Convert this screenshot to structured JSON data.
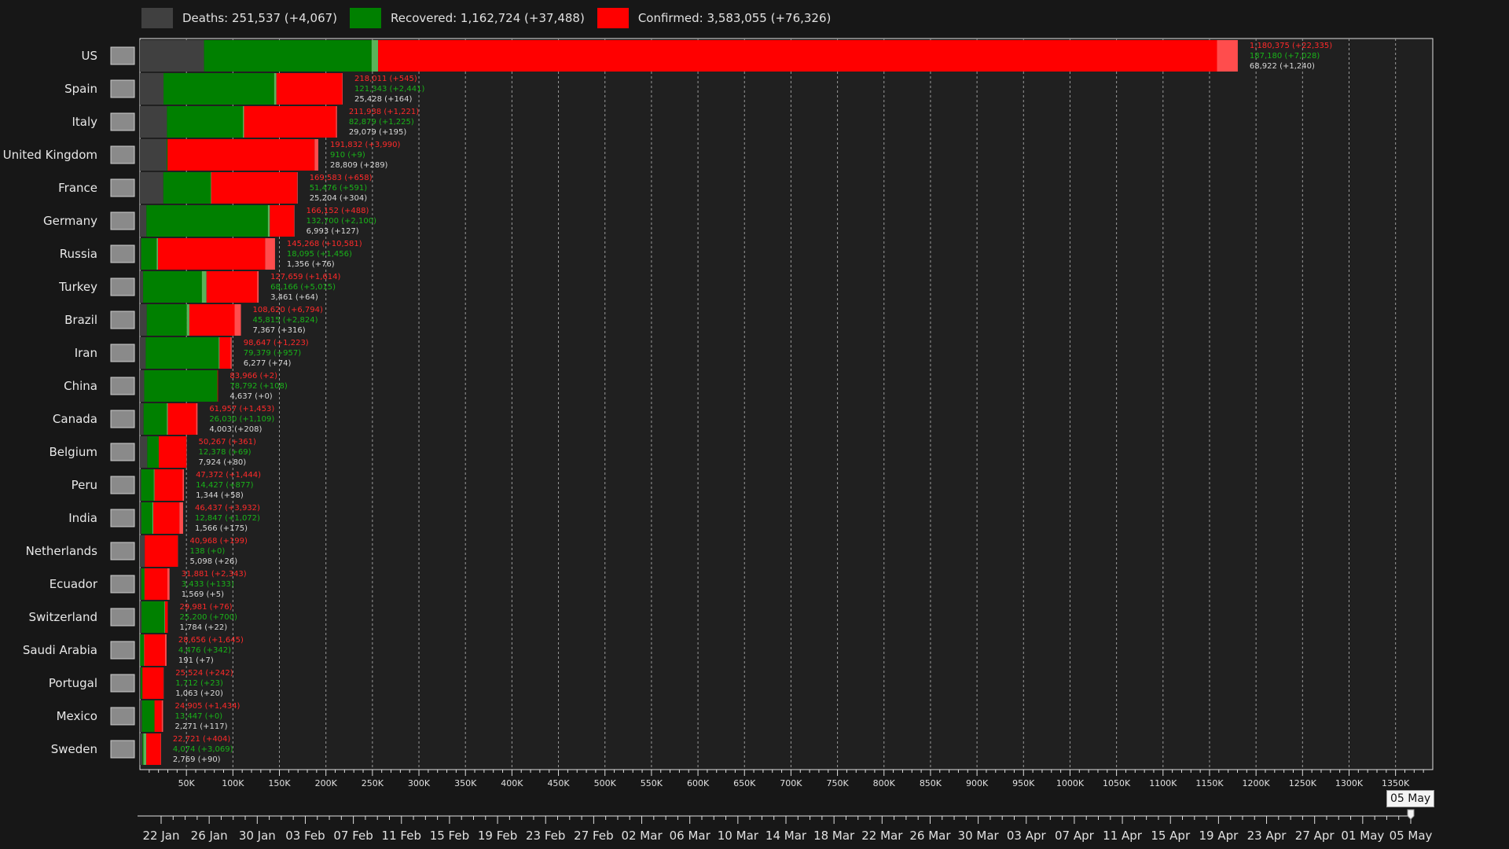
{
  "legend": [
    {
      "label": "Deaths: 251,537 (+4,067)",
      "color": "#404040"
    },
    {
      "label": "Recovered: 1,162,724 (+37,488)",
      "color": "#008000"
    },
    {
      "label": "Confirmed: 3,583,055 (+76,326)",
      "color": "#ff0000"
    }
  ],
  "colors": {
    "deaths": "#404040",
    "recovered": "#008000",
    "confirmed": "#ff0000",
    "confirmed_new": "#ff4d4d",
    "recovered_new": "#59b359",
    "text_red": "#ff2a2a",
    "text_green": "#19b219",
    "text_gray": "#d8d8d8"
  },
  "chart_data": {
    "type": "bar",
    "orientation": "horizontal",
    "xlim": [
      0,
      1390000
    ],
    "x_ticks": [
      "50K",
      "100K",
      "150K",
      "200K",
      "250K",
      "300K",
      "350K",
      "400K",
      "450K",
      "500K",
      "550K",
      "600K",
      "650K",
      "700K",
      "750K",
      "800K",
      "850K",
      "900K",
      "950K",
      "1000K",
      "1050K",
      "1100K",
      "1150K",
      "1200K",
      "1250K",
      "1300K",
      "1350K"
    ],
    "grid": true,
    "rows": [
      {
        "country": "US",
        "flag": "us-flag-icon",
        "confirmed": 1180375,
        "confirmed_new": 22335,
        "recovered": 187180,
        "recovered_new": 7028,
        "deaths": 68922,
        "deaths_new": 1240,
        "confirmed_label": "1,180,375 (+22,335)",
        "recovered_label": "187,180 (+7,028)",
        "deaths_label": "68,922 (+1,240)"
      },
      {
        "country": "Spain",
        "flag": "spain-flag-icon",
        "confirmed": 218011,
        "confirmed_new": 545,
        "recovered": 121343,
        "recovered_new": 2441,
        "deaths": 25428,
        "deaths_new": 164,
        "confirmed_label": "218,011 (+545)",
        "recovered_label": "121,343 (+2,441)",
        "deaths_label": "25,428 (+164)"
      },
      {
        "country": "Italy",
        "flag": "italy-flag-icon",
        "confirmed": 211938,
        "confirmed_new": 1221,
        "recovered": 82879,
        "recovered_new": 1225,
        "deaths": 29079,
        "deaths_new": 195,
        "confirmed_label": "211,938 (+1,221)",
        "recovered_label": "82,879 (+1,225)",
        "deaths_label": "29,079 (+195)"
      },
      {
        "country": "United Kingdom",
        "flag": "uk-flag-icon",
        "confirmed": 191832,
        "confirmed_new": 3990,
        "recovered": 910,
        "recovered_new": 9,
        "deaths": 28809,
        "deaths_new": 289,
        "confirmed_label": "191,832 (+3,990)",
        "recovered_label": "910 (+9)",
        "deaths_label": "28,809 (+289)"
      },
      {
        "country": "France",
        "flag": "france-flag-icon",
        "confirmed": 169583,
        "confirmed_new": 658,
        "recovered": 51476,
        "recovered_new": 591,
        "deaths": 25204,
        "deaths_new": 304,
        "confirmed_label": "169,583 (+658)",
        "recovered_label": "51,476 (+591)",
        "deaths_label": "25,204 (+304)"
      },
      {
        "country": "Germany",
        "flag": "germany-flag-icon",
        "confirmed": 166152,
        "confirmed_new": 488,
        "recovered": 132700,
        "recovered_new": 2100,
        "deaths": 6993,
        "deaths_new": 127,
        "confirmed_label": "166,152 (+488)",
        "recovered_label": "132,700 (+2,100)",
        "deaths_label": "6,993 (+127)"
      },
      {
        "country": "Russia",
        "flag": "russia-flag-icon",
        "confirmed": 145268,
        "confirmed_new": 10581,
        "recovered": 18095,
        "recovered_new": 1456,
        "deaths": 1356,
        "deaths_new": 76,
        "confirmed_label": "145,268 (+10,581)",
        "recovered_label": "18,095 (+1,456)",
        "deaths_label": "1,356 (+76)"
      },
      {
        "country": "Turkey",
        "flag": "turkey-flag-icon",
        "confirmed": 127659,
        "confirmed_new": 1614,
        "recovered": 68166,
        "recovered_new": 5015,
        "deaths": 3461,
        "deaths_new": 64,
        "confirmed_label": "127,659 (+1,614)",
        "recovered_label": "68,166 (+5,015)",
        "deaths_label": "3,461 (+64)"
      },
      {
        "country": "Brazil",
        "flag": "brazil-flag-icon",
        "confirmed": 108620,
        "confirmed_new": 6794,
        "recovered": 45815,
        "recovered_new": 2824,
        "deaths": 7367,
        "deaths_new": 316,
        "confirmed_label": "108,620 (+6,794)",
        "recovered_label": "45,815 (+2,824)",
        "deaths_label": "7,367 (+316)"
      },
      {
        "country": "Iran",
        "flag": "iran-flag-icon",
        "confirmed": 98647,
        "confirmed_new": 1223,
        "recovered": 79379,
        "recovered_new": 957,
        "deaths": 6277,
        "deaths_new": 74,
        "confirmed_label": "98,647 (+1,223)",
        "recovered_label": "79,379 (+957)",
        "deaths_label": "6,277 (+74)"
      },
      {
        "country": "China",
        "flag": "china-flag-icon",
        "confirmed": 83966,
        "confirmed_new": 2,
        "recovered": 78792,
        "recovered_new": 108,
        "deaths": 4637,
        "deaths_new": 0,
        "confirmed_label": "83,966 (+2)",
        "recovered_label": "78,792 (+108)",
        "deaths_label": "4,637 (+0)"
      },
      {
        "country": "Canada",
        "flag": "canada-flag-icon",
        "confirmed": 61957,
        "confirmed_new": 1453,
        "recovered": 26030,
        "recovered_new": 1109,
        "deaths": 4003,
        "deaths_new": 208,
        "confirmed_label": "61,957 (+1,453)",
        "recovered_label": "26,030 (+1,109)",
        "deaths_label": "4,003 (+208)"
      },
      {
        "country": "Belgium",
        "flag": "belgium-flag-icon",
        "confirmed": 50267,
        "confirmed_new": 361,
        "recovered": 12378,
        "recovered_new": 69,
        "deaths": 7924,
        "deaths_new": 80,
        "confirmed_label": "50,267 (+361)",
        "recovered_label": "12,378 (+69)",
        "deaths_label": "7,924 (+80)"
      },
      {
        "country": "Peru",
        "flag": "peru-flag-icon",
        "confirmed": 47372,
        "confirmed_new": 1444,
        "recovered": 14427,
        "recovered_new": 877,
        "deaths": 1344,
        "deaths_new": 58,
        "confirmed_label": "47,372 (+1,444)",
        "recovered_label": "14,427 (+877)",
        "deaths_label": "1,344 (+58)"
      },
      {
        "country": "India",
        "flag": "india-flag-icon",
        "confirmed": 46437,
        "confirmed_new": 3932,
        "recovered": 12847,
        "recovered_new": 1072,
        "deaths": 1566,
        "deaths_new": 175,
        "confirmed_label": "46,437 (+3,932)",
        "recovered_label": "12,847 (+1,072)",
        "deaths_label": "1,566 (+175)"
      },
      {
        "country": "Netherlands",
        "flag": "netherlands-flag-icon",
        "confirmed": 40968,
        "confirmed_new": 199,
        "recovered": 138,
        "recovered_new": 0,
        "deaths": 5098,
        "deaths_new": 26,
        "confirmed_label": "40,968 (+199)",
        "recovered_label": "138 (+0)",
        "deaths_label": "5,098 (+26)"
      },
      {
        "country": "Ecuador",
        "flag": "ecuador-flag-icon",
        "confirmed": 31881,
        "confirmed_new": 2343,
        "recovered": 3433,
        "recovered_new": 133,
        "deaths": 1569,
        "deaths_new": 5,
        "confirmed_label": "31,881 (+2,343)",
        "recovered_label": "3,433 (+133)",
        "deaths_label": "1,569 (+5)"
      },
      {
        "country": "Switzerland",
        "flag": "switzerland-flag-icon",
        "confirmed": 29981,
        "confirmed_new": 76,
        "recovered": 25200,
        "recovered_new": 700,
        "deaths": 1784,
        "deaths_new": 22,
        "confirmed_label": "29,981 (+76)",
        "recovered_label": "25,200 (+700)",
        "deaths_label": "1,784 (+22)"
      },
      {
        "country": "Saudi Arabia",
        "flag": "saudi-arabia-flag-icon",
        "confirmed": 28656,
        "confirmed_new": 1645,
        "recovered": 4476,
        "recovered_new": 342,
        "deaths": 191,
        "deaths_new": 7,
        "confirmed_label": "28,656 (+1,645)",
        "recovered_label": "4,476 (+342)",
        "deaths_label": "191 (+7)"
      },
      {
        "country": "Portugal",
        "flag": "portugal-flag-icon",
        "confirmed": 25524,
        "confirmed_new": 242,
        "recovered": 1712,
        "recovered_new": 23,
        "deaths": 1063,
        "deaths_new": 20,
        "confirmed_label": "25,524 (+242)",
        "recovered_label": "1,712 (+23)",
        "deaths_label": "1,063 (+20)"
      },
      {
        "country": "Mexico",
        "flag": "mexico-flag-icon",
        "confirmed": 24905,
        "confirmed_new": 1434,
        "recovered": 13447,
        "recovered_new": 0,
        "deaths": 2271,
        "deaths_new": 117,
        "confirmed_label": "24,905 (+1,434)",
        "recovered_label": "13,447 (+0)",
        "deaths_label": "2,271 (+117)"
      },
      {
        "country": "Sweden",
        "flag": "sweden-flag-icon",
        "confirmed": 22721,
        "confirmed_new": 404,
        "recovered": 4074,
        "recovered_new": 3069,
        "deaths": 2769,
        "deaths_new": 90,
        "confirmed_label": "22,721 (+404)",
        "recovered_label": "4,074 (+3,069)",
        "deaths_label": "2,769 (+90)"
      }
    ]
  },
  "timeline": {
    "labels": [
      "22 Jan",
      "26 Jan",
      "30 Jan",
      "03 Feb",
      "07 Feb",
      "11 Feb",
      "15 Feb",
      "19 Feb",
      "23 Feb",
      "27 Feb",
      "02 Mar",
      "06 Mar",
      "10 Mar",
      "14 Mar",
      "18 Mar",
      "22 Mar",
      "26 Mar",
      "30 Mar",
      "03 Apr",
      "07 Apr",
      "11 Apr",
      "15 Apr",
      "19 Apr",
      "23 Apr",
      "27 Apr",
      "01 May",
      "05 May"
    ],
    "current_date": "05 May",
    "current_index": 26
  }
}
